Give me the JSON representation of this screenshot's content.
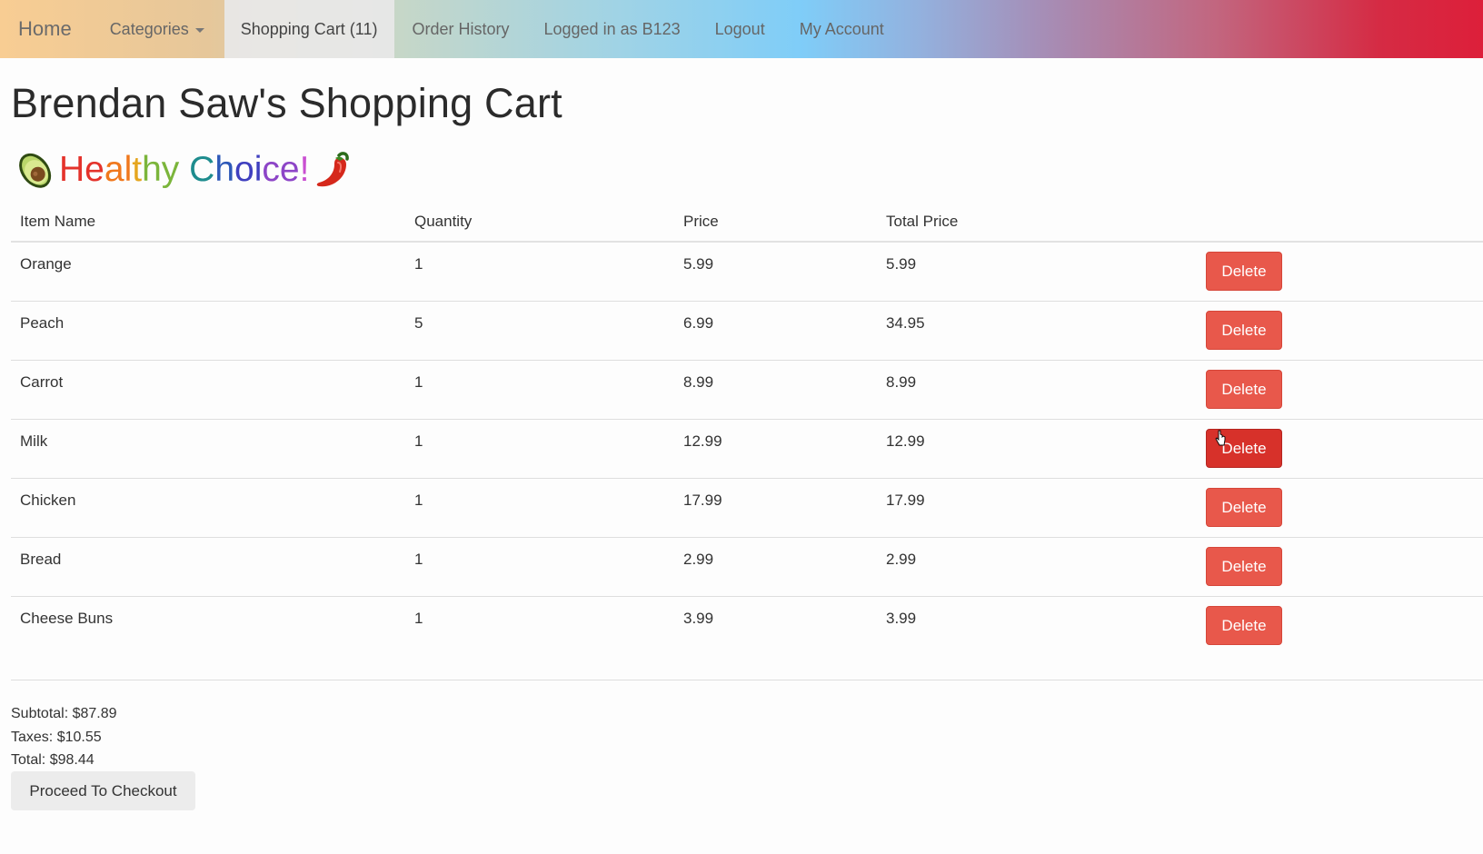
{
  "navbar": {
    "brand": "Home",
    "categories": "Categories",
    "cart": "Shopping Cart (11)",
    "order_history": "Order History",
    "logged_in": "Logged in as B123",
    "logout": "Logout",
    "account": "My Account"
  },
  "page": {
    "title": "Brendan Saw's Shopping Cart",
    "tagline": "Healthy Choice!",
    "tagline_left_icon": "avocado-icon",
    "tagline_right_icon": "chili-pepper-icon"
  },
  "table": {
    "headers": [
      "Item Name",
      "Quantity",
      "Price",
      "Total Price"
    ],
    "rows": [
      {
        "name": "Orange",
        "qty": "1",
        "price": "5.99",
        "total": "5.99",
        "action": "Delete"
      },
      {
        "name": "Peach",
        "qty": "5",
        "price": "6.99",
        "total": "34.95",
        "action": "Delete"
      },
      {
        "name": "Carrot",
        "qty": "1",
        "price": "8.99",
        "total": "8.99",
        "action": "Delete"
      },
      {
        "name": "Milk",
        "qty": "1",
        "price": "12.99",
        "total": "12.99",
        "action": "Delete"
      },
      {
        "name": "Chicken",
        "qty": "1",
        "price": "17.99",
        "total": "17.99",
        "action": "Delete"
      },
      {
        "name": "Bread",
        "qty": "1",
        "price": "2.99",
        "total": "2.99",
        "action": "Delete"
      },
      {
        "name": "Cheese Buns",
        "qty": "1",
        "price": "3.99",
        "total": "3.99",
        "action": "Delete"
      }
    ]
  },
  "summary": {
    "subtotal": "Subtotal: $87.89",
    "taxes": "Taxes: $10.55",
    "total": "Total: $98.44",
    "checkout": "Proceed To Checkout"
  },
  "colors": {
    "delete": "#e8584b",
    "delete_hover": "#d7312a",
    "checkout": "#ececec"
  }
}
